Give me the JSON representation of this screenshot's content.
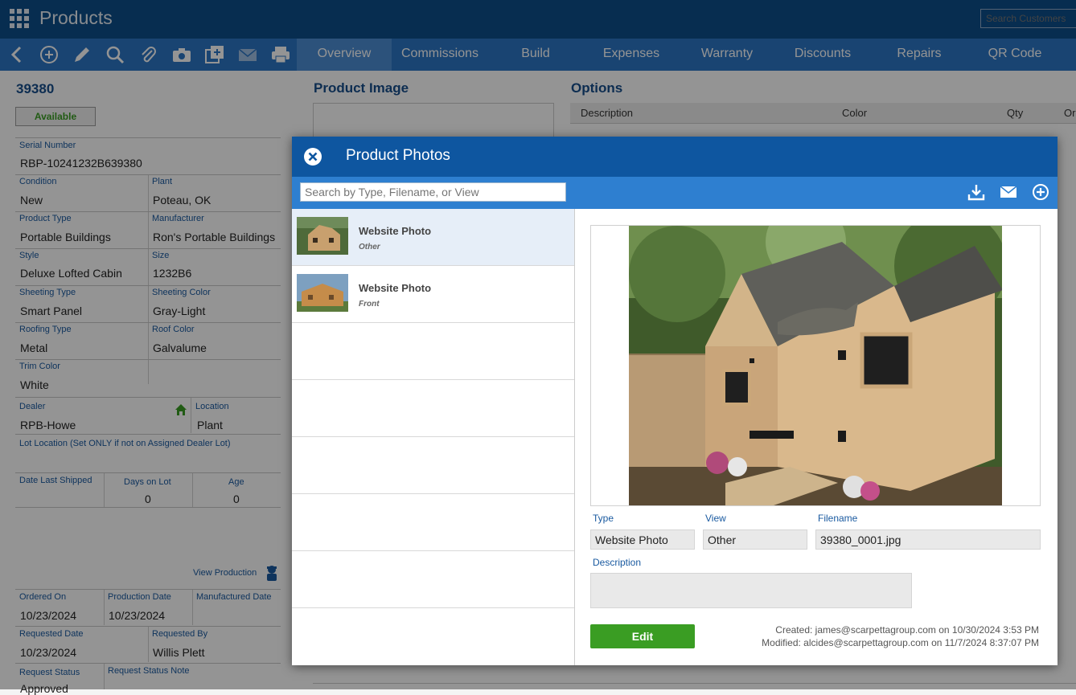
{
  "app": {
    "title": "Products",
    "search_placeholder": "Search Customers"
  },
  "tabs": [
    "Overview",
    "Commissions",
    "Build",
    "Expenses",
    "Warranty",
    "Discounts",
    "Repairs",
    "QR Code"
  ],
  "toolbar_icons": [
    "back-icon",
    "add-icon",
    "edit-icon",
    "search-icon",
    "attach-icon",
    "camera-icon",
    "copy-icon",
    "email-icon",
    "print-icon"
  ],
  "product": {
    "id": "39380",
    "status": "Available",
    "serial_label": "Serial Number",
    "serial": "RBP-10241232B639380",
    "condition_label": "Condition",
    "condition": "New",
    "plant_label": "Plant",
    "plant": "Poteau, OK",
    "type_label": "Product Type",
    "type": "Portable Buildings",
    "manufacturer_label": "Manufacturer",
    "manufacturer": "Ron's Portable Buildings",
    "style_label": "Style",
    "style": "Deluxe Lofted Cabin",
    "size_label": "Size",
    "size": "1232B6",
    "sheeting_type_label": "Sheeting Type",
    "sheeting_type": "Smart Panel",
    "sheeting_color_label": "Sheeting Color",
    "sheeting_color": "Gray-Light",
    "roofing_type_label": "Roofing Type",
    "roofing_type": "Metal",
    "roof_color_label": "Roof Color",
    "roof_color": "Galvalume",
    "trim_color_label": "Trim Color",
    "trim_color": "White",
    "dealer_label": "Dealer",
    "dealer": "RPB-Howe",
    "location_label": "Location",
    "location": "Plant",
    "lot_location_label": "Lot Location (Set ONLY if not on Assigned Dealer Lot)",
    "date_last_shipped_label": "Date Last Shipped",
    "days_on_lot_label": "Days on Lot",
    "days_on_lot": "0",
    "age_label": "Age",
    "age": "0",
    "view_production": "View Production",
    "ordered_on_label": "Ordered On",
    "ordered_on": "10/23/2024",
    "production_date_label": "Production Date",
    "production_date": "10/23/2024",
    "manufactured_date_label": "Manufactured Date",
    "requested_date_label": "Requested Date",
    "requested_date": "10/23/2024",
    "requested_by_label": "Requested By",
    "requested_by": "Willis Plett",
    "request_status_label": "Request Status",
    "request_status": "Approved",
    "request_status_note_label": "Request Status Note"
  },
  "sections": {
    "product_image": "Product Image",
    "options": "Options"
  },
  "options_table": {
    "columns": [
      "Description",
      "Color",
      "Qty",
      "Or"
    ]
  },
  "modal": {
    "title": "Product Photos",
    "search_placeholder": "Search by Type, Filename, or View",
    "photos": [
      {
        "type": "Website Photo",
        "view": "Other"
      },
      {
        "type": "Website Photo",
        "view": "Front"
      }
    ],
    "detail": {
      "type_label": "Type",
      "type": "Website Photo",
      "view_label": "View",
      "view": "Other",
      "filename_label": "Filename",
      "filename": "39380_0001.jpg",
      "description_label": "Description",
      "description": "",
      "edit_label": "Edit",
      "created": "Created: james@scarpettagroup.com on 10/30/2024 3:53 PM",
      "modified": "Modified: alcides@scarpettagroup.com on 11/7/2024 8:37:07 PM"
    }
  },
  "colors": {
    "header": "#0d4f8b",
    "toolbar": "#2b75c4",
    "accent_green": "#3a9d23",
    "label_blue": "#1a5aa0"
  }
}
